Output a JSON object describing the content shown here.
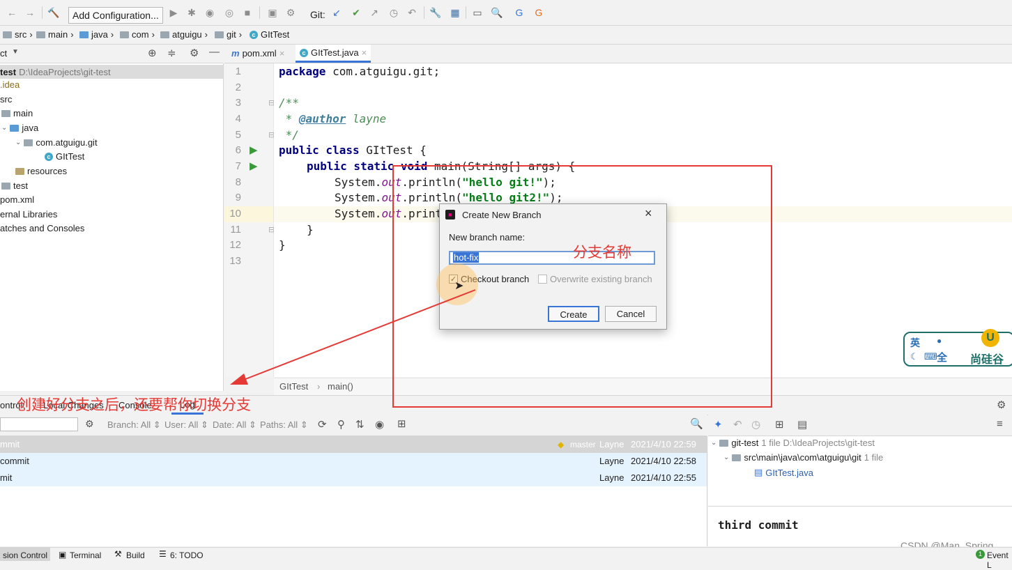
{
  "toolbar": {
    "add_config_label": "Add Configuration...",
    "git_label": "Git:"
  },
  "breadcrumb": [
    "src",
    "main",
    "java",
    "com",
    "atguigu",
    "git",
    "GItTest"
  ],
  "project_panel": {
    "title": "ct",
    "tree": [
      {
        "label": "test",
        "extra": "D:\\IdeaProjects\\git-test"
      },
      {
        "label": ".idea"
      },
      {
        "label": "src"
      },
      {
        "label": "main"
      },
      {
        "label": "java"
      },
      {
        "label": "com.atguigu.git"
      },
      {
        "label": "GItTest"
      },
      {
        "label": "resources"
      },
      {
        "label": "test"
      },
      {
        "label": "pom.xml"
      },
      {
        "label": "ernal Libraries"
      },
      {
        "label": "atches and Consoles"
      }
    ]
  },
  "editor": {
    "tabs": [
      "pom.xml",
      "GItTest.java"
    ],
    "line_numbers": [
      "1",
      "2",
      "3",
      "4",
      "5",
      "6",
      "7",
      "8",
      "9",
      "10",
      "11",
      "12",
      "13"
    ],
    "code": {
      "l1_kw": "package",
      "l1_rest": " com.atguigu.git;",
      "l3": "/**",
      "l4_a": " * ",
      "l4_ann": "@author",
      "l4_b": " layne",
      "l5": " */",
      "l6_kw": "public class",
      "l6_rest": " GItTest {",
      "l7_kw": "public static void",
      "l7_rest": " main(String[] args) {",
      "l8_a": "System.",
      "l8_fld": "out",
      "l8_b": ".println(",
      "l8_str": "\"hello git!\"",
      "l8_c": ");",
      "l9_a": "System.",
      "l9_fld": "out",
      "l9_b": ".println(",
      "l9_str": "\"hello git2!\"",
      "l9_c": ");",
      "l10_a": "System.",
      "l10_fld": "out",
      "l10_b": ".print",
      "l11": "}",
      "l12": "}"
    },
    "breadcrumb": [
      "GItTest",
      "main()"
    ]
  },
  "dialog": {
    "title": "Create New Branch",
    "field_label": "New branch name:",
    "branch_name": "hot-fix",
    "checkout_label": "Checkout branch",
    "checkout_checked": true,
    "overwrite_label": "Overwrite existing branch",
    "overwrite_checked": false,
    "create_label": "Create",
    "cancel_label": "Cancel"
  },
  "annotations": {
    "branch_name_note": "分支名称",
    "switch_note": "创建好分支之后，还要帮你切换分支"
  },
  "bottom": {
    "tabs": [
      "ontrol:",
      "Local Changes",
      "Console",
      "Log"
    ],
    "filters": [
      "Branch: All",
      "User: All",
      "Date: All",
      "Paths: All"
    ],
    "log_rows": [
      {
        "msg": "mmit",
        "branch": "master",
        "author": "Layne",
        "date": "2021/4/10 22:59"
      },
      {
        "msg": "commit",
        "branch": "",
        "author": "Layne",
        "date": "2021/4/10 22:58"
      },
      {
        "msg": "mit",
        "branch": "",
        "author": "Layne",
        "date": "2021/4/10 22:55"
      }
    ],
    "changes_tree": {
      "root": "git-test",
      "root_meta": "1 file  D:\\IdeaProjects\\git-test",
      "dir": "src\\main\\java\\com\\atguigu\\git",
      "dir_meta": "1 file",
      "file": "GItTest.java"
    },
    "commit_message": "third commit"
  },
  "statusbar": {
    "items": [
      "sion Control",
      "Terminal",
      "Build",
      "6: TODO"
    ],
    "right": "Event L",
    "watermark": "CSDN @Man_Spring",
    "event_count": "1"
  },
  "logo": {
    "text": "尚硅谷",
    "ime_chars": "英",
    "ime_full": "全"
  },
  "colors": {
    "accent": "#3875d7",
    "annotation": "#e53935",
    "selection": "#e5f3ff"
  }
}
